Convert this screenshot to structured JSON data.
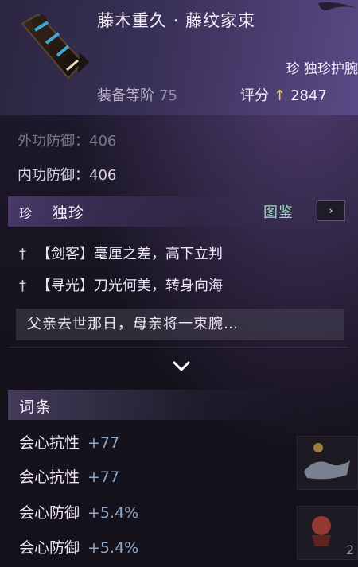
{
  "item": {
    "name": "藤木重久 · 藤纹家束",
    "quality_badge": "珍",
    "quality_text": "独珍护腕",
    "level_label": "装备等阶",
    "level_value": "75",
    "score_label": "评分",
    "score_arrow": "↑",
    "score_value": "2847"
  },
  "stats": {
    "outer_defense": "外功防御：406",
    "inner_defense": "内功防御：406"
  },
  "set_section": {
    "badge": "珍",
    "title": "独珍",
    "atlas_label": "图鉴",
    "atlas_button": "›"
  },
  "traits": [
    {
      "tag": "【剑客】",
      "text": "毫厘之差，高下立判"
    },
    {
      "tag": "【寻光】",
      "text": "刀光何美，转身向海"
    }
  ],
  "lore": "父亲去世那日，母亲将一束腕…",
  "entries_section": {
    "title": "词条",
    "items": [
      {
        "name": "会心抗性",
        "value": "+77"
      },
      {
        "name": "会心抗性",
        "value": "+77"
      },
      {
        "name": "会心防御",
        "value": "+5.4%"
      },
      {
        "name": "会心防御",
        "value": "+5.4%"
      }
    ]
  },
  "side_slot_count": "2",
  "colors": {
    "accent_purple": "#5a4a86",
    "atlas_green": "#9fd9c4",
    "score_arrow": "#f5d25a",
    "entry_value": "#8ea7c9"
  }
}
